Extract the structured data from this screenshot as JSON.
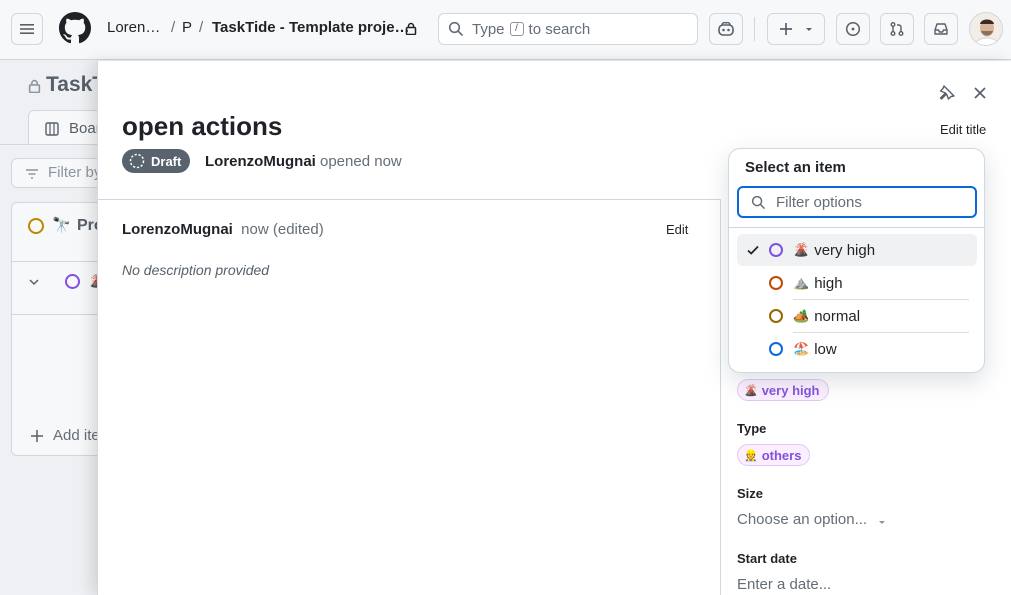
{
  "header": {
    "breadcrumb_owner": "Loren…",
    "breadcrumb_sep1": "/",
    "breadcrumb_project_short": "P",
    "breadcrumb_sep2": "/",
    "breadcrumb_project": "TaskTide - Template proje…",
    "search_prefix": "Type",
    "search_key": "/",
    "search_suffix": "to search"
  },
  "background": {
    "title": "TaskT",
    "tab_label": "Boar",
    "filter_placeholder": "Filter by",
    "column_title": "Pro",
    "add_item": "Add ite"
  },
  "panel": {
    "title": "open actions",
    "edit_title": "Edit title",
    "status_badge": "Draft",
    "opened_author": "LorenzoMugnai",
    "opened_text": "opened now",
    "comment_author": "LorenzoMugnai",
    "comment_time": "now (edited)",
    "comment_edit": "Edit",
    "comment_body": "No description provided",
    "fields": {
      "priority_value": "very high",
      "priority_emoji": "🌋",
      "type_label": "Type",
      "type_value": "others",
      "type_emoji": "👷",
      "size_label": "Size",
      "size_placeholder": "Choose an option...",
      "start_label": "Start date",
      "start_placeholder": "Enter a date..."
    }
  },
  "dropdown": {
    "title": "Select an item",
    "filter_placeholder": "Filter options",
    "options": [
      {
        "label": "very high",
        "emoji": "🌋",
        "color": "#8250df",
        "selected": true
      },
      {
        "label": "high",
        "emoji": "⛰️",
        "color": "#bc4c00",
        "selected": false
      },
      {
        "label": "normal",
        "emoji": "🏕️",
        "color": "#9a6700",
        "selected": false
      },
      {
        "label": "low",
        "emoji": "🏖️",
        "color": "#0969da",
        "selected": false
      }
    ]
  },
  "colors": {
    "accent": "#0969da",
    "draft_badge": "#59636e",
    "priority_pill": "#8250df"
  }
}
